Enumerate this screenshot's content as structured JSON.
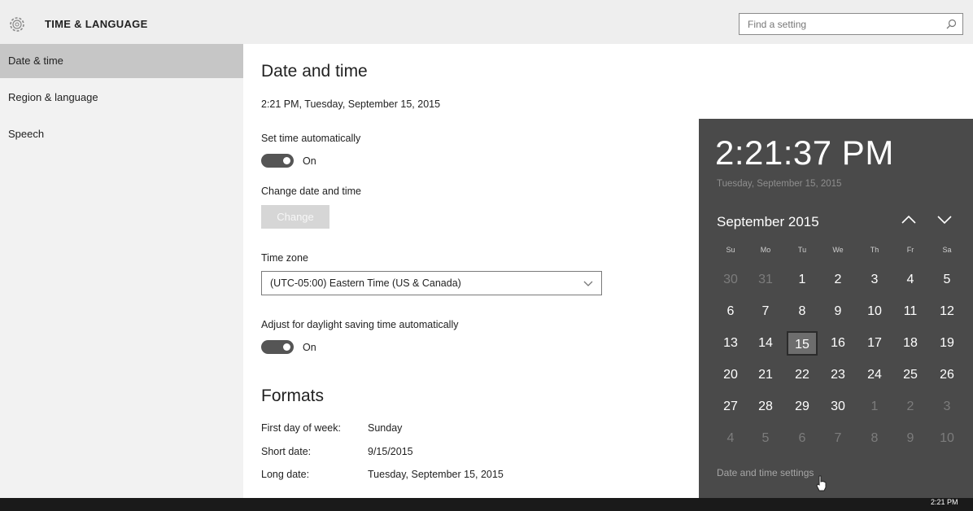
{
  "header": {
    "title": "TIME & LANGUAGE",
    "search_placeholder": "Find a setting"
  },
  "sidebar": {
    "items": [
      {
        "label": "Date & time",
        "active": true
      },
      {
        "label": "Region & language",
        "active": false
      },
      {
        "label": "Speech",
        "active": false
      }
    ]
  },
  "main": {
    "title": "Date and time",
    "current_datetime": "2:21 PM, Tuesday, September 15, 2015",
    "set_time_auto_label": "Set time automatically",
    "set_time_auto_state": "On",
    "change_label": "Change date and time",
    "change_button": "Change",
    "timezone_label": "Time zone",
    "timezone_value": "(UTC-05:00) Eastern Time (US & Canada)",
    "dst_label": "Adjust for daylight saving time automatically",
    "dst_state": "On",
    "formats_title": "Formats",
    "formats": [
      {
        "label": "First day of week:",
        "value": "Sunday"
      },
      {
        "label": "Short date:",
        "value": "9/15/2015"
      },
      {
        "label": "Long date:",
        "value": "Tuesday, September 15, 2015"
      }
    ]
  },
  "flyout": {
    "time": "2:21:37 PM",
    "date": "Tuesday, September 15, 2015",
    "month_label": "September 2015",
    "weekdays": [
      "Su",
      "Mo",
      "Tu",
      "We",
      "Th",
      "Fr",
      "Sa"
    ],
    "weeks": [
      [
        {
          "d": "30",
          "dim": true
        },
        {
          "d": "31",
          "dim": true
        },
        {
          "d": "1"
        },
        {
          "d": "2"
        },
        {
          "d": "3"
        },
        {
          "d": "4"
        },
        {
          "d": "5"
        }
      ],
      [
        {
          "d": "6"
        },
        {
          "d": "7"
        },
        {
          "d": "8"
        },
        {
          "d": "9"
        },
        {
          "d": "10"
        },
        {
          "d": "11"
        },
        {
          "d": "12"
        }
      ],
      [
        {
          "d": "13"
        },
        {
          "d": "14"
        },
        {
          "d": "15",
          "today": true
        },
        {
          "d": "16"
        },
        {
          "d": "17"
        },
        {
          "d": "18"
        },
        {
          "d": "19"
        }
      ],
      [
        {
          "d": "20"
        },
        {
          "d": "21"
        },
        {
          "d": "22"
        },
        {
          "d": "23"
        },
        {
          "d": "24"
        },
        {
          "d": "25"
        },
        {
          "d": "26"
        }
      ],
      [
        {
          "d": "27"
        },
        {
          "d": "28"
        },
        {
          "d": "29"
        },
        {
          "d": "30"
        },
        {
          "d": "1",
          "dim": true
        },
        {
          "d": "2",
          "dim": true
        },
        {
          "d": "3",
          "dim": true
        }
      ],
      [
        {
          "d": "4",
          "dim": true
        },
        {
          "d": "5",
          "dim": true
        },
        {
          "d": "6",
          "dim": true
        },
        {
          "d": "7",
          "dim": true
        },
        {
          "d": "8",
          "dim": true
        },
        {
          "d": "9",
          "dim": true
        },
        {
          "d": "10",
          "dim": true
        }
      ]
    ],
    "settings_link": "Date and time settings"
  },
  "taskbar": {
    "clock": "2:21 PM"
  },
  "colors": {
    "flyout_bg": "#4a4a4a",
    "toggle_on": "#555555",
    "sidebar_active": "#c6c6c6"
  }
}
